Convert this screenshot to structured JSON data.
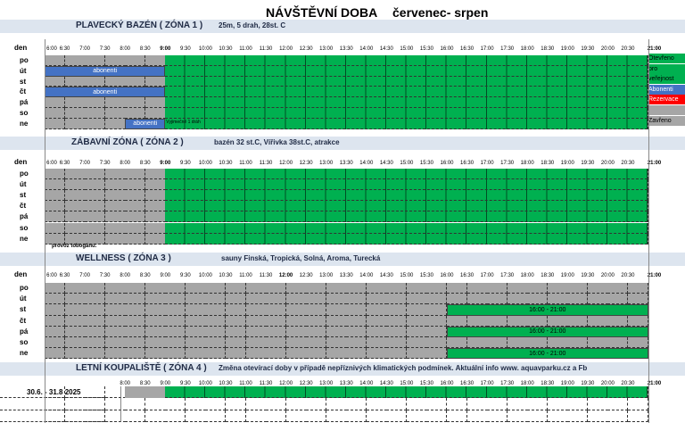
{
  "title": "NÁVŠTĚVNÍ DOBA",
  "subtitle": "červenec- srpen",
  "colors": {
    "green": "#00b050",
    "gray": "#a6a6a6",
    "blue": "#4472c4",
    "red": "#ff0000",
    "banner": "#dde5ef"
  },
  "day_header": "den",
  "days": [
    "po",
    "út",
    "st",
    "čt",
    "pá",
    "so",
    "ne"
  ],
  "times": [
    "6:00",
    "6:30",
    "7:00",
    "7:30",
    "8:00",
    "8:30",
    "9:00",
    "9:30",
    "10:00",
    "10:30",
    "11:00",
    "11:30",
    "12:00",
    "12:30",
    "13:00",
    "13:30",
    "14:00",
    "14:30",
    "15:00",
    "15:30",
    "16:00",
    "16:30",
    "17:00",
    "17:30",
    "18:00",
    "18:30",
    "19:00",
    "19:30",
    "20:00",
    "20:30",
    "21:00"
  ],
  "zones": [
    {
      "id": "zona1",
      "name": "PLAVECKÝ BAZÉN  ( ZÓNA 1 )",
      "info": "25m, 5 drah, 28st. C",
      "bold_time": "9:00",
      "legend": [
        {
          "label": "Otevřeno",
          "color": "#00b050"
        },
        {
          "label": "pro",
          "color": "#00b050"
        },
        {
          "label": "veřejnost",
          "color": "#00b050"
        },
        {
          "label": "Abonenti",
          "color": "#4472c4"
        },
        {
          "label": "Rezervace",
          "color": "#ff0000"
        },
        {
          "label": "",
          "color": "#a6a6a6"
        },
        {
          "label": "Zavřeno",
          "color": "#a6a6a6"
        }
      ],
      "rows": [
        {
          "open_from": 6,
          "green_to": 30,
          "bars": [
            {
              "from": 6,
              "to": 30,
              "color": "#00b050"
            }
          ]
        },
        {
          "open_from": 6,
          "green_to": 30,
          "bars": [
            {
              "from": 0,
              "to": 6,
              "color": "#4472c4",
              "text": "abonenti"
            },
            {
              "from": 6,
              "to": 30,
              "color": "#00b050"
            }
          ]
        },
        {
          "open_from": 6,
          "green_to": 30,
          "bars": [
            {
              "from": 6,
              "to": 30,
              "color": "#00b050"
            }
          ]
        },
        {
          "open_from": 6,
          "green_to": 30,
          "bars": [
            {
              "from": 0,
              "to": 6,
              "color": "#4472c4",
              "text": "abonenti"
            },
            {
              "from": 6,
              "to": 30,
              "color": "#00b050"
            }
          ]
        },
        {
          "open_from": 6,
          "green_to": 30,
          "bars": [
            {
              "from": 6,
              "to": 30,
              "color": "#00b050"
            }
          ]
        },
        {
          "open_from": 6,
          "green_to": 30,
          "bars": [
            {
              "from": 6,
              "to": 30,
              "color": "#00b050"
            }
          ]
        },
        {
          "open_from": 6,
          "green_to": 30,
          "bars": [
            {
              "from": 4,
              "to": 6,
              "color": "#4472c4",
              "text": "abonenti"
            },
            {
              "from": 6,
              "to": 30,
              "color": "#00b050"
            }
          ],
          "note": "Vyjimečně 1 dráh"
        }
      ]
    },
    {
      "id": "zona2",
      "name": "ZÁBAVNÍ ZÓNA  ( ZÓNA 2 )",
      "info": "bazén 32 st.C, Vířivka 38st.C, atrakce",
      "bold_time": "9:00",
      "footer_note": "provoz tobogánu:",
      "rows": [
        {
          "bars": [
            {
              "from": 6,
              "to": 30,
              "color": "#00b050"
            }
          ]
        },
        {
          "bars": [
            {
              "from": 6,
              "to": 30,
              "color": "#00b050"
            }
          ]
        },
        {
          "bars": [
            {
              "from": 6,
              "to": 30,
              "color": "#00b050"
            }
          ]
        },
        {
          "bars": [
            {
              "from": 6,
              "to": 30,
              "color": "#00b050"
            }
          ]
        },
        {
          "bars": [
            {
              "from": 6,
              "to": 30,
              "color": "#00b050"
            }
          ]
        },
        {
          "bars": [
            {
              "from": 6,
              "to": 30,
              "color": "#00b050"
            }
          ]
        },
        {
          "bars": [
            {
              "from": 6,
              "to": 30,
              "color": "#00b050"
            }
          ]
        }
      ]
    },
    {
      "id": "zona3",
      "name": "WELLNESS  ( ZÓNA 3 )",
      "info": "sauny Finská, Tropická, Solná, Aroma, Turecká",
      "bold_time": "12:00",
      "rows": [
        {
          "bars": []
        },
        {
          "bars": []
        },
        {
          "bars": [
            {
              "from": 20,
              "to": 30,
              "color": "#00b050",
              "text": "16:00 - 21:00"
            }
          ]
        },
        {
          "bars": []
        },
        {
          "bars": [
            {
              "from": 20,
              "to": 30,
              "color": "#00b050",
              "text": "16:00 - 21:00"
            }
          ]
        },
        {
          "bars": []
        },
        {
          "bars": [
            {
              "from": 20,
              "to": 30,
              "color": "#00b050",
              "text": "16:00 - 21:00"
            }
          ]
        }
      ]
    },
    {
      "id": "zona4",
      "name": "LETNÍ KOUPALIŠTĚ  ( ZÓNA 4 )",
      "info": "Změna otevírací doby v případě nepříznivých klimatických podmínek. Aktuální info www. aquavparku.cz a Fb",
      "date_range": "30.6.  -  31.8 2025",
      "times_subset_from": 4,
      "rows": [
        {
          "bars": [
            {
              "from": 4,
              "to": 6,
              "color": "#a6a6a6"
            },
            {
              "from": 6,
              "to": 30,
              "color": "#00b050"
            }
          ]
        },
        {
          "bars": []
        },
        {
          "bars": []
        }
      ]
    }
  ]
}
